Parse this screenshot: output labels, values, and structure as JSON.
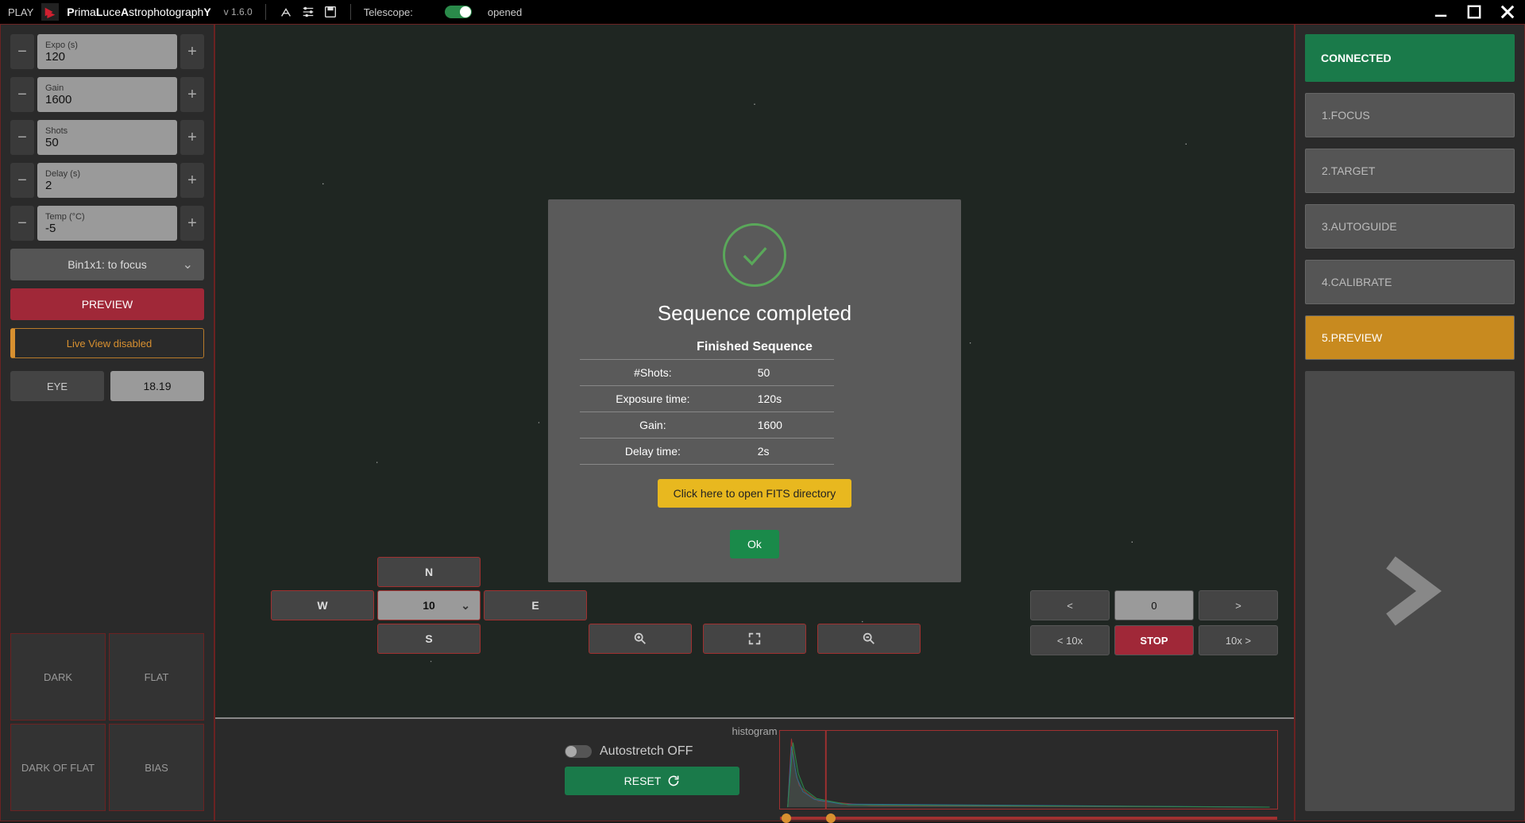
{
  "topbar": {
    "play": "PLAY",
    "app_name_html": "PrimaLuceAstrophotographY",
    "version": "v 1.6.0",
    "telescope_label": "Telescope:",
    "telescope_state": "opened"
  },
  "left": {
    "expo": {
      "label": "Expo (s)",
      "value": "120"
    },
    "gain": {
      "label": "Gain",
      "value": "1600"
    },
    "shots": {
      "label": "Shots",
      "value": "50"
    },
    "delay": {
      "label": "Delay (s)",
      "value": "2"
    },
    "temp": {
      "label": "Temp (°C)",
      "value": "-5"
    },
    "bin": "Bin1x1: to focus",
    "preview_btn": "PREVIEW",
    "liveview": "Live View disabled",
    "eye_label": "EYE",
    "eye_value": "18.19",
    "grid": {
      "dark": "DARK",
      "flat": "FLAT",
      "darkflat": "DARK OF FLAT",
      "bias": "BIAS"
    }
  },
  "dpad": {
    "n": "N",
    "w": "W",
    "speed": "10",
    "e": "E",
    "s": "S"
  },
  "nav": {
    "lt": "<",
    "zero": "0",
    "gt": ">",
    "lt10": "< 10x",
    "stop": "STOP",
    "gt10": "10x >"
  },
  "histo": {
    "title": "histogram",
    "autostretch": "Autostretch OFF",
    "reset": "RESET"
  },
  "modal": {
    "title": "Sequence completed",
    "subtitle": "Finished Sequence",
    "rows": {
      "shots_label": "#Shots:",
      "shots_val": "50",
      "expo_label": "Exposure time:",
      "expo_val": "120s",
      "gain_label": "Gain:",
      "gain_val": "1600",
      "delay_label": "Delay time:",
      "delay_val": "2s"
    },
    "fits_btn": "Click here to open FITS directory",
    "ok_btn": "Ok"
  },
  "right": {
    "status": "CONNECTED",
    "steps": {
      "s1": "1.FOCUS",
      "s2": "2.TARGET",
      "s3": "3.AUTOGUIDE",
      "s4": "4.CALIBRATE",
      "s5": "5.PREVIEW"
    }
  }
}
